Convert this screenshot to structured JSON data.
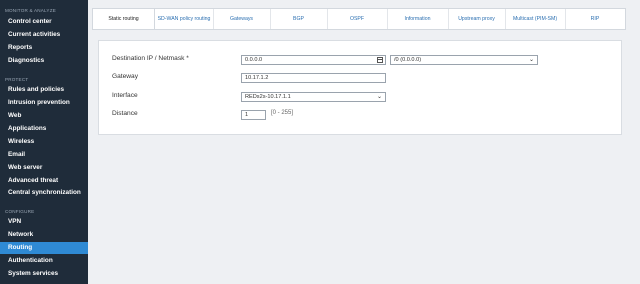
{
  "sidebar": {
    "sections": [
      {
        "label": "MONITOR & ANALYZE",
        "items": [
          "Control center",
          "Current activities",
          "Reports",
          "Diagnostics"
        ]
      },
      {
        "label": "PROTECT",
        "items": [
          "Rules and policies",
          "Intrusion prevention",
          "Web",
          "Applications",
          "Wireless",
          "Email",
          "Web server",
          "Advanced threat",
          "Central synchronization"
        ]
      },
      {
        "label": "CONFIGURE",
        "items": [
          "VPN",
          "Network",
          "Routing",
          "Authentication",
          "System services"
        ]
      }
    ],
    "active_item": "Routing",
    "active_color": "#2f8ad4",
    "bg_color": "#1f2c3a"
  },
  "tabs": [
    {
      "label": "Static routing",
      "active": true
    },
    {
      "label": "SD-WAN policy routing",
      "active": false
    },
    {
      "label": "Gateways",
      "active": false
    },
    {
      "label": "BGP",
      "active": false
    },
    {
      "label": "OSPF",
      "active": false
    },
    {
      "label": "Information",
      "active": false
    },
    {
      "label": "Upstream proxy",
      "active": false
    },
    {
      "label": "Multicast (PIM-SM)",
      "active": false
    },
    {
      "label": "RIP",
      "active": false
    }
  ],
  "form": {
    "dest_label": "Destination IP / Netmask *",
    "dest_ip_value": "0.0.0.0",
    "netmask_value": "/0 (0.0.0.0)",
    "gateway_label": "Gateway",
    "gateway_value": "10.17.1.2",
    "interface_label": "Interface",
    "interface_value": "REDs2s-10.17.1.1",
    "distance_label": "Distance",
    "distance_value": "1",
    "distance_hint": "[0 - 255]"
  }
}
